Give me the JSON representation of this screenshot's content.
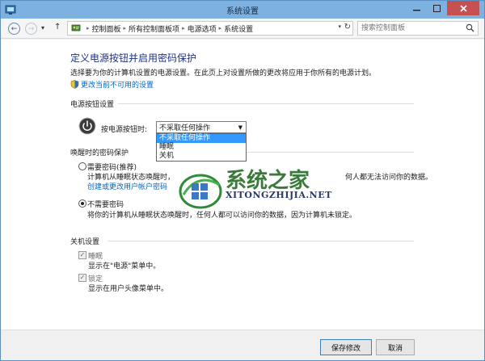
{
  "window": {
    "title": "系统设置"
  },
  "nav": {
    "back_glyph": "←",
    "forward_glyph": "→",
    "recent_glyph": "▾",
    "up_glyph": "↑"
  },
  "address": {
    "crumbs": [
      "控制面板",
      "所有控制面板项",
      "电源选项",
      "系统设置"
    ],
    "separator": "▸",
    "dropdown_glyph": "▾",
    "refresh_glyph": "↻"
  },
  "search": {
    "placeholder": "搜索控制面板"
  },
  "page": {
    "heading": "定义电源按钮并启用密码保护",
    "description": "选择要为你的计算机设置的电源设置。在此页上对设置所做的更改将应用于你所有的电源计划。",
    "change_link": "更改当前不可用的设置"
  },
  "power_button": {
    "section_title": "电源按钮设置",
    "label": "按电源按钮时:",
    "selected": "不采取任何操作",
    "options": [
      "不采取任何操作",
      "睡眠",
      "关机"
    ]
  },
  "wake_password": {
    "section_title": "唤醒时的密码保护",
    "require": {
      "label": "需要密码(推荐)",
      "desc_left": "计算机从睡眠状态唤醒时，",
      "desc_right": "何人都无法访问你的数据。",
      "link": "创建或更改用户帐户密码"
    },
    "no_password": {
      "label": "不需要密码",
      "desc": "将你的计算机从睡眠状态唤醒时，任何人都可以访问你的数据，因为计算机未锁定。"
    }
  },
  "shutdown": {
    "section_title": "关机设置",
    "sleep": {
      "label": "睡眠",
      "desc": "显示在\"电源\"菜单中。"
    },
    "lock": {
      "label": "锁定",
      "desc": "显示在用户头像菜单中。"
    }
  },
  "watermark": {
    "brand": "系统之家",
    "domain": "XITONGZHIJIA.NET"
  },
  "buttons": {
    "save": "保存修改",
    "cancel": "取消"
  },
  "colors": {
    "titlebar": "#7cb1e0",
    "heading": "#1e3287",
    "link": "#0066cc",
    "selection": "#3399ff",
    "close": "#c75050"
  }
}
